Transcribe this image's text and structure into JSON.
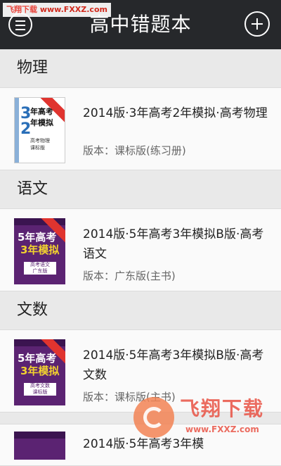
{
  "watermark_top": {
    "brand": "飞翔下载",
    "url": "www.FXXZ.com"
  },
  "header": {
    "title": "高中错题本",
    "menu_icon": "menu-icon",
    "add_icon": "add-icon"
  },
  "sections": [
    {
      "name": "物理",
      "book": {
        "title": "2014版·3年高考2年模拟·高考物理",
        "version": "版本：课标版(练习册)",
        "cover": {
          "big": "3 2",
          "line1": "年高考",
          "line2": "年模拟",
          "sub1": "高考物理",
          "sub2": "课标版"
        }
      }
    },
    {
      "name": "语文",
      "book": {
        "title": "2014版·5年高考3年模拟B版·高考语文",
        "version": "版本：广东版(主书)",
        "cover": {
          "line1": "5年高考",
          "line2": "3年模拟",
          "sub1": "高考语文",
          "sub2": "广东版"
        }
      }
    },
    {
      "name": "文数",
      "book": {
        "title": "2014版·5年高考3年模拟B版·高考文数",
        "version": "版本：课标版(主书)",
        "cover": {
          "line1": "5年高考",
          "line2": "3年模拟",
          "sub1": "高考文数",
          "sub2": "课标版"
        }
      }
    }
  ],
  "partial_next": {
    "title": "2014版·5年高考3年模"
  },
  "watermark_br": {
    "brand": "飞翔下载",
    "url": "www.FXXZ.com"
  },
  "colors": {
    "topbar": "#26282b",
    "background": "#e9e9e9",
    "row": "#fafafa",
    "cover_purple": "#5b2372",
    "ribbon": "#e0342f"
  }
}
